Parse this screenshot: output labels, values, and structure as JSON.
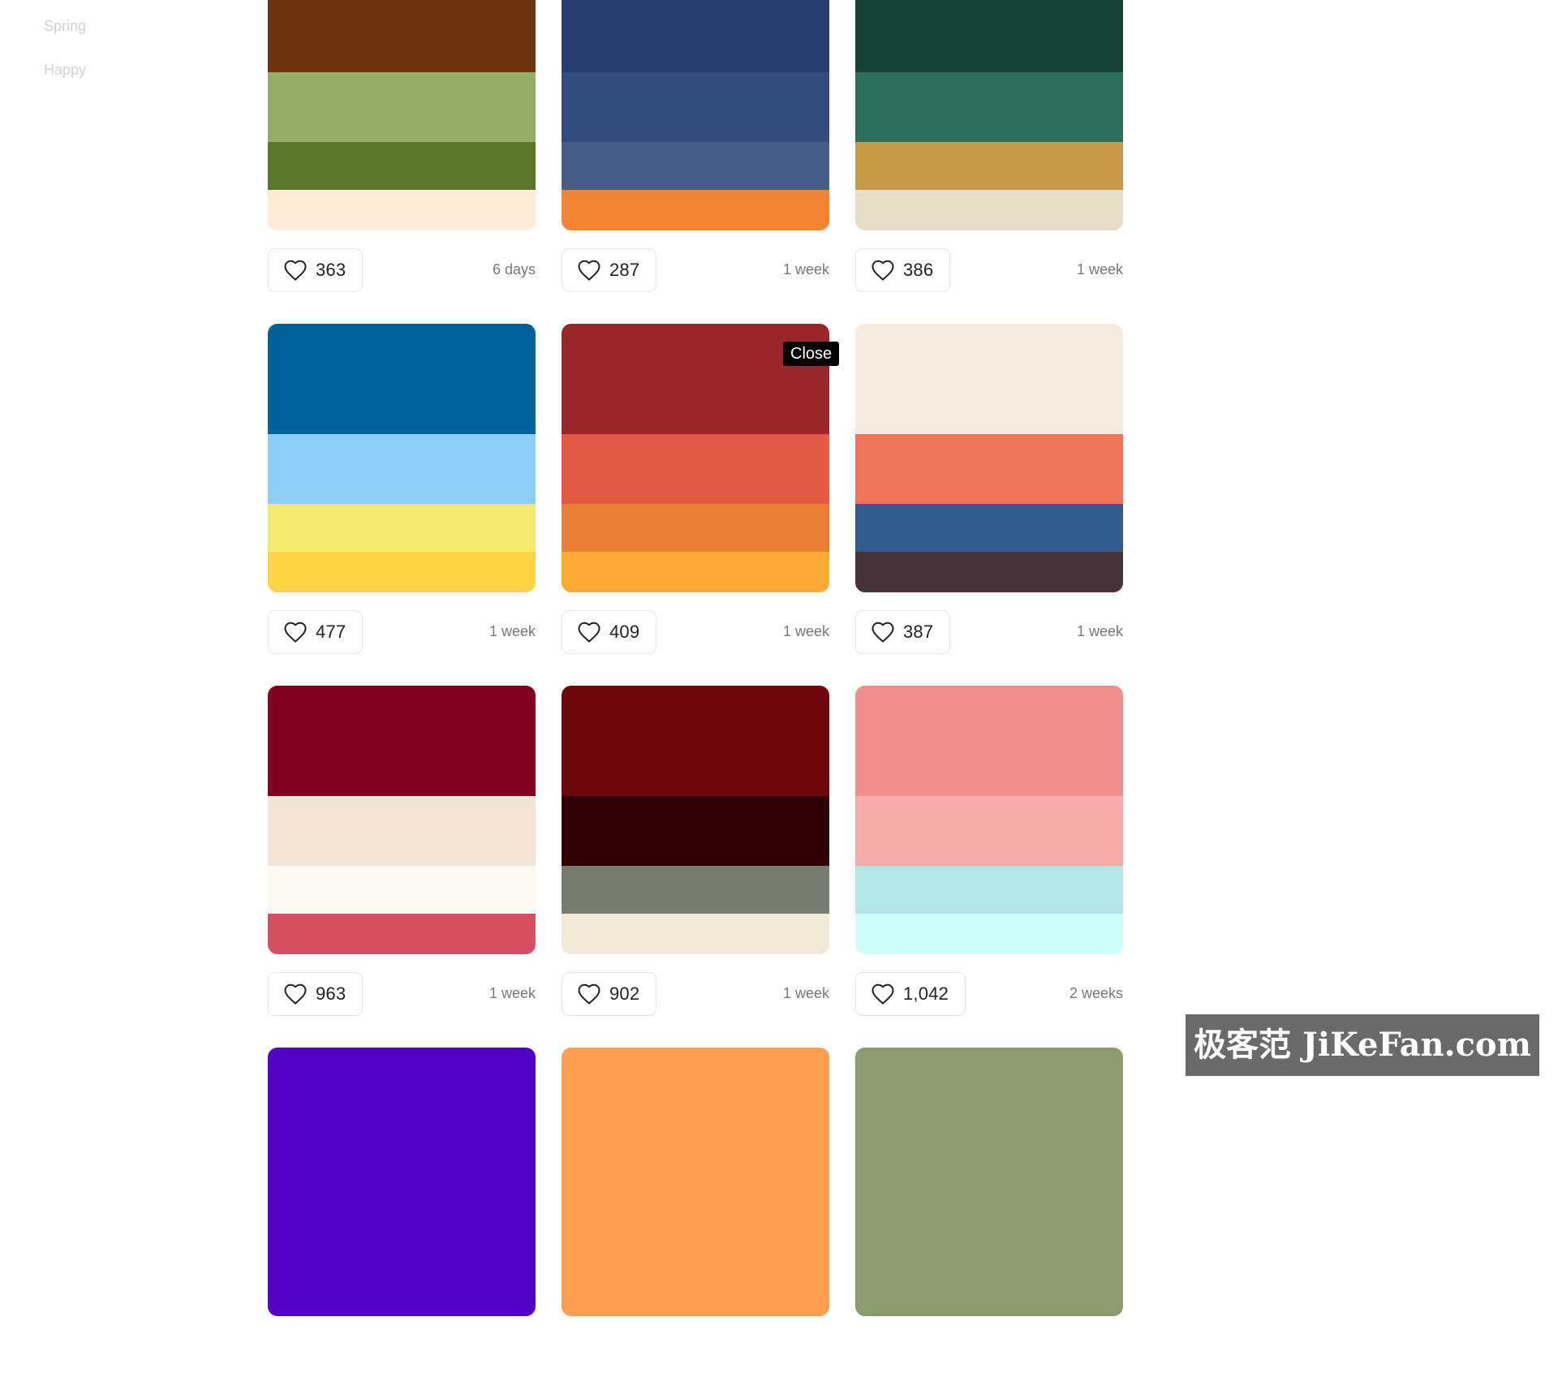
{
  "sidebar": {
    "text_color": "#d2d2d2",
    "links": [
      {
        "label": "Spring"
      },
      {
        "label": "Happy"
      }
    ]
  },
  "tooltip": {
    "label": "Close"
  },
  "watermark": {
    "text": "极客范 JiKeFan.com"
  },
  "palettes": [
    {
      "colors": [
        "#6e3412",
        "#94ad67",
        "#5a772b",
        "#fdebd8"
      ],
      "likes": "363",
      "age": "6 days"
    },
    {
      "colors": [
        "#283d6f",
        "#344b7f",
        "#485c8a",
        "#f38434"
      ],
      "likes": "287",
      "age": "1 week"
    },
    {
      "colors": [
        "#16443a",
        "#2c6f5e",
        "#c79a48",
        "#e8dec7"
      ],
      "likes": "386",
      "age": "1 week"
    },
    {
      "colors": [
        "#01629a",
        "#8dcef6",
        "#f4ea6d",
        "#ffd546"
      ],
      "likes": "477",
      "age": "1 week"
    },
    {
      "colors": [
        "#99272a",
        "#e35943",
        "#ea7e34",
        "#fdab34"
      ],
      "likes": "409",
      "age": "1 week"
    },
    {
      "colors": [
        "#f6eade",
        "#f0735c",
        "#325c8e",
        "#443337"
      ],
      "likes": "387",
      "age": "1 week"
    },
    {
      "colors": [
        "#80001d",
        "#f3e5d6",
        "#fff8f3",
        "#d44f63"
      ],
      "likes": "963",
      "age": "1 week"
    },
    {
      "colors": [
        "#6e070b",
        "#300002",
        "#777d6d",
        "#f2e8d8"
      ],
      "likes": "902",
      "age": "1 week"
    },
    {
      "colors": [
        "#ef8f8f",
        "#f7aaaa",
        "#b5e6e6",
        "#cdfcfa"
      ],
      "likes": "1,042",
      "age": "2 weeks"
    },
    {
      "colors": [
        "#5300c6"
      ]
    },
    {
      "colors": [
        "#ff9e50"
      ]
    },
    {
      "colors": [
        "#8b9b6e"
      ]
    }
  ]
}
